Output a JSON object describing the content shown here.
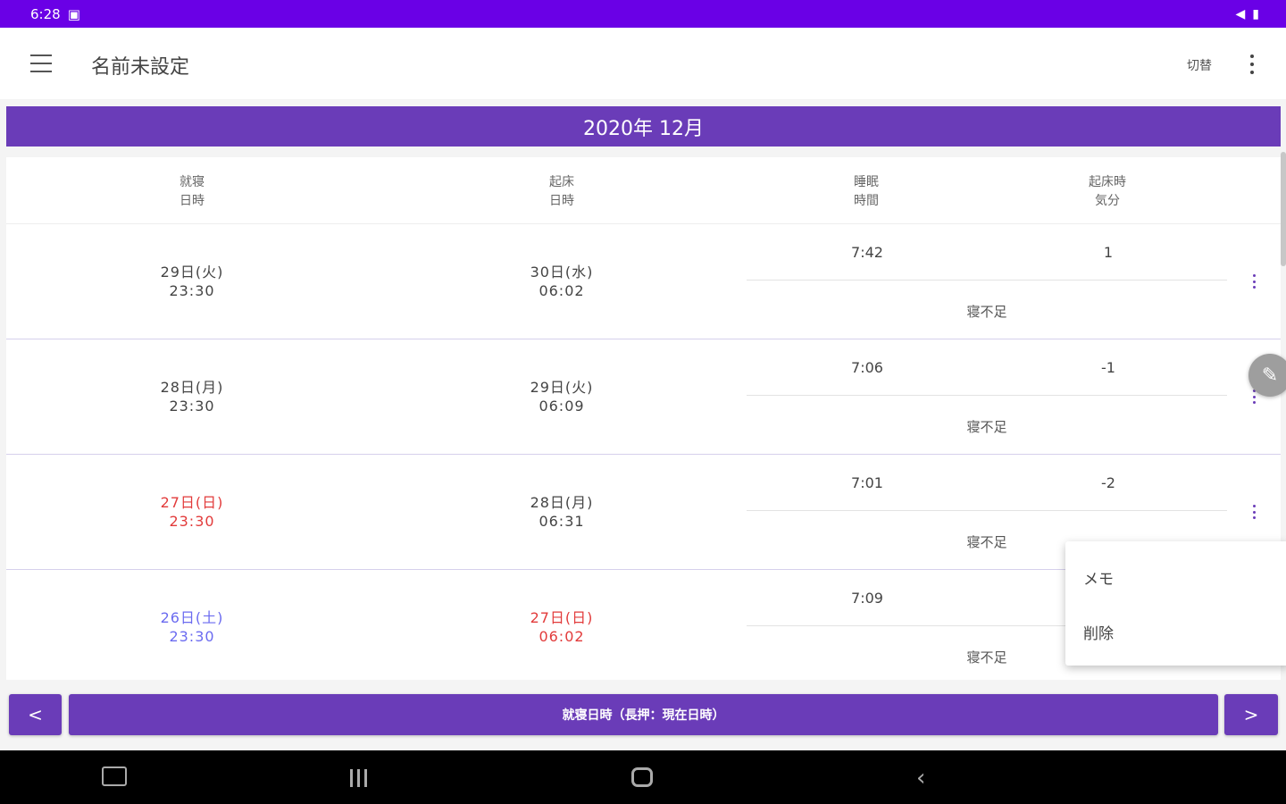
{
  "status_bar": {
    "time": "6:28",
    "left_icon": "notification-icon",
    "right_icons": [
      "volume-icon",
      "battery-icon"
    ]
  },
  "app_bar": {
    "title": "名前未設定",
    "switch_label": "切替"
  },
  "month_header": "2020年 12月",
  "table": {
    "columns": [
      "就寝\n日時",
      "起床\n日時",
      "睡眠\n時間",
      "起床時\n気分"
    ],
    "rows": [
      {
        "bed": "29日(火)\n23:30",
        "bed_type": "normal",
        "wake": "30日(水)\n06:02",
        "wake_type": "normal",
        "sleep": "7:42",
        "mood": "1",
        "note": "寝不足"
      },
      {
        "bed": "28日(月)\n23:30",
        "bed_type": "normal",
        "wake": "29日(火)\n06:09",
        "wake_type": "normal",
        "sleep": "7:06",
        "mood": "-1",
        "note": "寝不足"
      },
      {
        "bed": "27日(日)\n23:30",
        "bed_type": "sunday",
        "wake": "28日(月)\n06:31",
        "wake_type": "normal",
        "sleep": "7:01",
        "mood": "-2",
        "note": "寝不足"
      },
      {
        "bed": "26日(土)\n23:30",
        "bed_type": "saturday",
        "wake": "27日(日)\n06:02",
        "wake_type": "sunday",
        "sleep": "7:09",
        "mood": "",
        "note": "寝不足"
      }
    ]
  },
  "popup_menu": {
    "items": [
      "メモ",
      "削除"
    ]
  },
  "bottom_nav": {
    "prev": "<",
    "main": "就寝日時（長押：現在日時）",
    "next": ">"
  },
  "colors": {
    "status_bar": "#6a00e6",
    "accent": "#6a3cb8",
    "sunday": "#e23b3b",
    "saturday": "#6b6bf0"
  }
}
